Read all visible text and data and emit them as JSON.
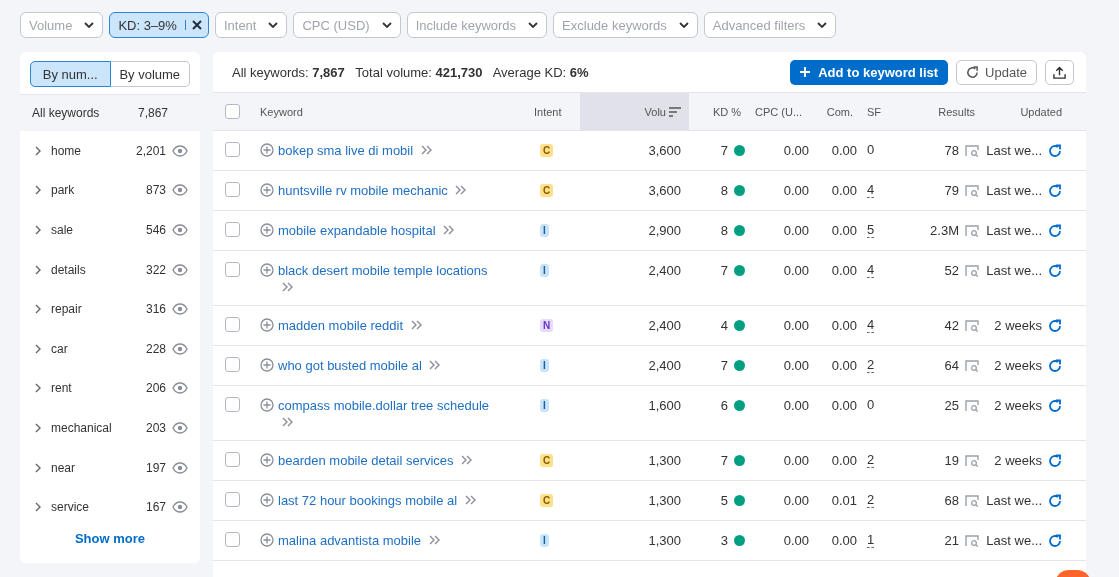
{
  "filters": [
    {
      "label": "Volume",
      "active": false
    },
    {
      "label": "KD: 3–9%",
      "active": true
    },
    {
      "label": "Intent",
      "active": false
    },
    {
      "label": "CPC (USD)",
      "active": false
    },
    {
      "label": "Include keywords",
      "active": false
    },
    {
      "label": "Exclude keywords",
      "active": false
    },
    {
      "label": "Advanced filters",
      "active": false
    }
  ],
  "sidebar": {
    "toggles": [
      {
        "label": "By num...",
        "selected": true
      },
      {
        "label": "By volume",
        "selected": false
      }
    ],
    "all": {
      "label": "All keywords",
      "count": "7,867"
    },
    "groups": [
      {
        "name": "home",
        "count": "2,201"
      },
      {
        "name": "park",
        "count": "873"
      },
      {
        "name": "sale",
        "count": "546"
      },
      {
        "name": "details",
        "count": "322"
      },
      {
        "name": "repair",
        "count": "316"
      },
      {
        "name": "car",
        "count": "228"
      },
      {
        "name": "rent",
        "count": "206"
      },
      {
        "name": "mechanical",
        "count": "203"
      },
      {
        "name": "near",
        "count": "197"
      },
      {
        "name": "service",
        "count": "167"
      }
    ],
    "show_more": "Show more"
  },
  "summary": "All keywords: **7,867**   Total volume: **421,730**   Average KD: **6%**",
  "actions": {
    "add": "Add to keyword list",
    "update": "Update"
  },
  "table": {
    "all_checked": false,
    "columns": [
      "Keyword",
      "Intent",
      "Volu",
      "KD %",
      "CPC (U...",
      "Com.",
      "SF",
      "Results",
      "Updated"
    ],
    "rows": [
      {
        "checked": false,
        "keyword": "bokep sma live di mobil",
        "intent": "C",
        "kind": "commercial",
        "volume": "3,600",
        "kd": "7",
        "cpc": "0.00",
        "com": "0.00",
        "sf": "0",
        "sf_link": false,
        "results": "78",
        "updated": "Last we..."
      },
      {
        "checked": false,
        "keyword": "huntsville rv mobile mechanic",
        "intent": "C",
        "kind": "commercial",
        "volume": "3,600",
        "kd": "8",
        "cpc": "0.00",
        "com": "0.00",
        "sf": "4",
        "sf_link": true,
        "results": "79",
        "updated": "Last we..."
      },
      {
        "checked": false,
        "keyword": "mobile expandable hospital",
        "intent": "I",
        "kind": "informational",
        "volume": "2,900",
        "kd": "8",
        "cpc": "0.00",
        "com": "0.00",
        "sf": "5",
        "sf_link": true,
        "results": "2.3M",
        "updated": "Last we..."
      },
      {
        "checked": false,
        "keyword": "black desert mobile temple locations",
        "intent": "I",
        "kind": "informational",
        "volume": "2,400",
        "kd": "7",
        "cpc": "0.00",
        "com": "0.00",
        "sf": "4",
        "sf_link": true,
        "results": "52",
        "updated": "Last we..."
      },
      {
        "checked": false,
        "keyword": "madden mobile reddit",
        "intent": "N",
        "kind": "navigational",
        "volume": "2,400",
        "kd": "4",
        "cpc": "0.00",
        "com": "0.00",
        "sf": "4",
        "sf_link": true,
        "results": "42",
        "updated": "2 weeks"
      },
      {
        "checked": false,
        "keyword": "who got busted mobile al",
        "intent": "I",
        "kind": "informational",
        "volume": "2,400",
        "kd": "7",
        "cpc": "0.00",
        "com": "0.00",
        "sf": "2",
        "sf_link": true,
        "results": "64",
        "updated": "2 weeks"
      },
      {
        "checked": false,
        "keyword": "compass mobile.dollar tree schedule",
        "intent": "I",
        "kind": "informational",
        "volume": "1,600",
        "kd": "6",
        "cpc": "0.00",
        "com": "0.00",
        "sf": "0",
        "sf_link": false,
        "results": "25",
        "updated": "2 weeks"
      },
      {
        "checked": false,
        "keyword": "bearden mobile detail services",
        "intent": "C",
        "kind": "commercial",
        "volume": "1,300",
        "kd": "7",
        "cpc": "0.00",
        "com": "0.00",
        "sf": "2",
        "sf_link": true,
        "results": "19",
        "updated": "2 weeks"
      },
      {
        "checked": false,
        "keyword": "last 72 hour bookings mobile al",
        "intent": "C",
        "kind": "commercial",
        "volume": "1,300",
        "kd": "5",
        "cpc": "0.00",
        "com": "0.01",
        "sf": "2",
        "sf_link": true,
        "results": "68",
        "updated": "Last we..."
      },
      {
        "checked": false,
        "keyword": "malina advantista mobile",
        "intent": "I",
        "kind": "informational",
        "volume": "1,300",
        "kd": "3",
        "cpc": "0.00",
        "com": "0.00",
        "sf": "1",
        "sf_link": true,
        "results": "21",
        "updated": "Last we..."
      }
    ]
  }
}
